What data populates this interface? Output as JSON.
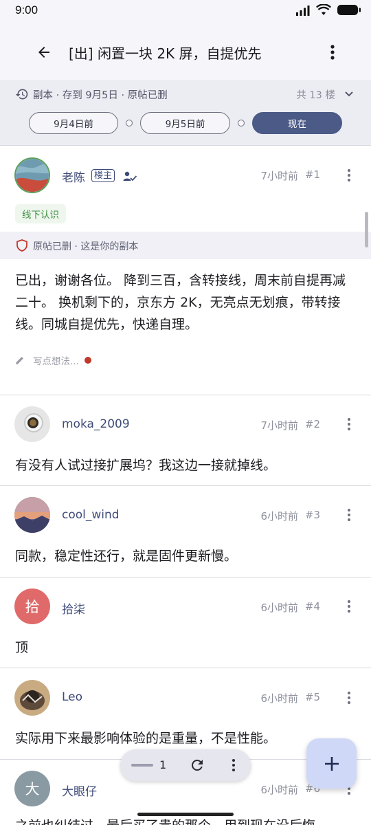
{
  "status_bar": {
    "time": "9:00"
  },
  "header": {
    "title": "[出] 闲置一块 2K 屏，自提优先"
  },
  "snapshot": {
    "info": "副本 · 存到 9月5日 · 原帖已删",
    "floor_count": "共 13 楼",
    "timeline": [
      "9月4日前",
      "9月5日前",
      "现在"
    ]
  },
  "posts": [
    {
      "author": "老陈",
      "badge": "楼主",
      "time": "7小时前",
      "floor": "#1",
      "tag": "线下认识",
      "deleted_notice": "原帖已删 · 这是你的副本",
      "content": "已出，谢谢各位。 降到三百，含转接线，周末前自提再减二十。 换机剩下的，京东方 2K，无亮点无划痕，带转接线。同城自提优先，快递自理。",
      "memo_placeholder": "写点想法..."
    },
    {
      "author": "moka_2009",
      "time": "7小时前",
      "floor": "#2",
      "content": "有没有人试过接扩展坞？我这边一接就掉线。"
    },
    {
      "author": "cool_wind",
      "time": "6小时前",
      "floor": "#3",
      "content": "同款，稳定性还行，就是固件更新慢。"
    },
    {
      "author": "拾柒",
      "avatar_letter": "拾",
      "time": "6小时前",
      "floor": "#4",
      "content": "顶"
    },
    {
      "author": "Leo",
      "time": "6小时前",
      "floor": "#5",
      "content": "实际用下来最影响体验的是重量，不是性能。"
    },
    {
      "author": "大眼仔",
      "avatar_letter": "大",
      "time": "6小时前",
      "floor": "#6",
      "content": "之前也纠结过，最后买了贵的那个，用到现在没后悔"
    }
  ],
  "pager": {
    "page": "1"
  },
  "colors": {
    "accent": "#4b5a86",
    "author": "#3e4b78",
    "fab": "#d0d8f8",
    "tag_text": "#3f8f3f"
  }
}
